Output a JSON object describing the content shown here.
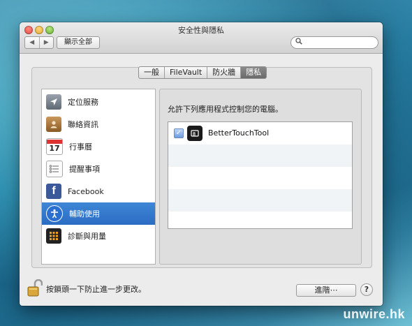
{
  "window": {
    "title": "安全性與隱私"
  },
  "toolbar": {
    "back_icon": "◀",
    "forward_icon": "▶",
    "show_all_label": "顯示全部",
    "search_placeholder": ""
  },
  "tabs": [
    {
      "label": "一般",
      "selected": false
    },
    {
      "label": "FileVault",
      "selected": false
    },
    {
      "label": "防火牆",
      "selected": false
    },
    {
      "label": "隱私",
      "selected": true
    }
  ],
  "sidebar": {
    "items": [
      {
        "label": "定位服務",
        "icon": "location-icon",
        "selected": false
      },
      {
        "label": "聯絡資訊",
        "icon": "contacts-icon",
        "selected": false
      },
      {
        "label": "行事曆",
        "icon": "calendar-icon",
        "calendar_day": "17",
        "selected": false
      },
      {
        "label": "提醒事項",
        "icon": "reminders-icon",
        "selected": false
      },
      {
        "label": "Facebook",
        "icon": "facebook-icon",
        "selected": false
      },
      {
        "label": "輔助使用",
        "icon": "accessibility-icon",
        "selected": true
      },
      {
        "label": "診斷與用量",
        "icon": "diagnostics-icon",
        "selected": false
      }
    ]
  },
  "main": {
    "description": "允許下列應用程式控制您的電腦。",
    "apps": [
      {
        "name": "BetterTouchTool",
        "checked": true,
        "icon": "bettertouchtool-icon"
      }
    ]
  },
  "footer": {
    "lock_text": "按鎖頭一下防止進一步更改。",
    "advanced_label": "進階⋯",
    "help_label": "?"
  },
  "watermark": "unwire.hk",
  "colors": {
    "selection": "#2f73c8",
    "tab_selected": "#7a7a7a"
  }
}
